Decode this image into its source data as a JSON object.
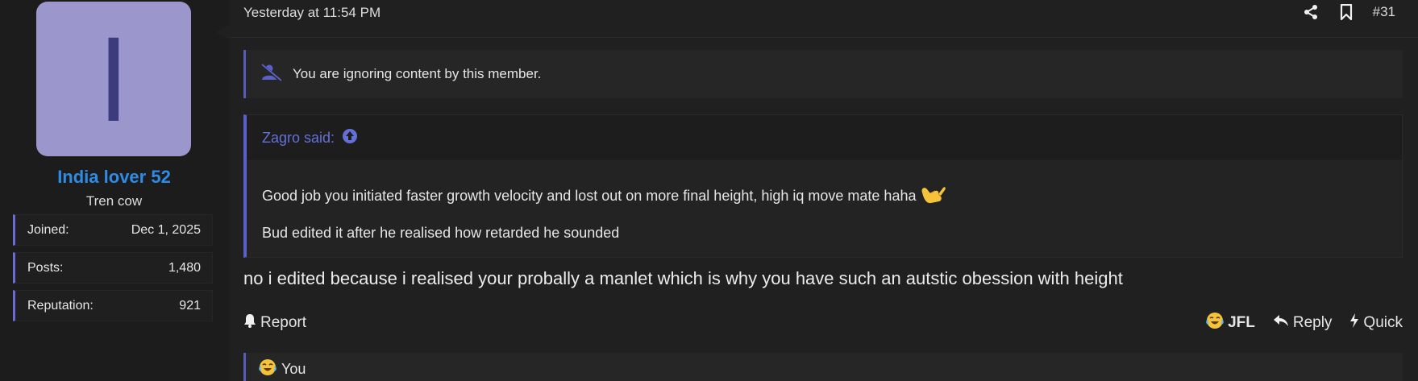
{
  "user": {
    "avatar_letter": "I",
    "avatar_bg": "#9b97cc",
    "avatar_fg": "#3b3b7e",
    "name": "India lover 52",
    "name_color": "#2f8be3",
    "title": "Tren cow",
    "stats": [
      {
        "label": "Joined:",
        "value": "Dec 1, 2025"
      },
      {
        "label": "Posts:",
        "value": "1,480"
      },
      {
        "label": "Reputation:",
        "value": "921"
      }
    ]
  },
  "post": {
    "timestamp": "Yesterday at 11:54 PM",
    "post_number": "#31",
    "header_icons": [
      "share-icon",
      "bookmark-icon"
    ],
    "ignored_notice": "You are ignoring content by this member.",
    "quote": {
      "author": "Zagro said:",
      "line1": "Good job you initiated faster growth velocity and lost out on more final height, high iq move mate haha",
      "line1_emoji": "call-me-hand-emoji",
      "line2": "Bud edited it after he realised how retarded he sounded"
    },
    "body": "no i edited because i realised your probally a manlet which is why you have such an autstic obession with height",
    "actions": {
      "report": "Report",
      "jfl": "JFL",
      "reply": "Reply",
      "quick": "Quick"
    },
    "reactions_text": "You"
  },
  "colors": {
    "accent": "#5a60c7",
    "link": "#6470d8",
    "bg": "#1c1c1c",
    "panel": "#202020"
  }
}
